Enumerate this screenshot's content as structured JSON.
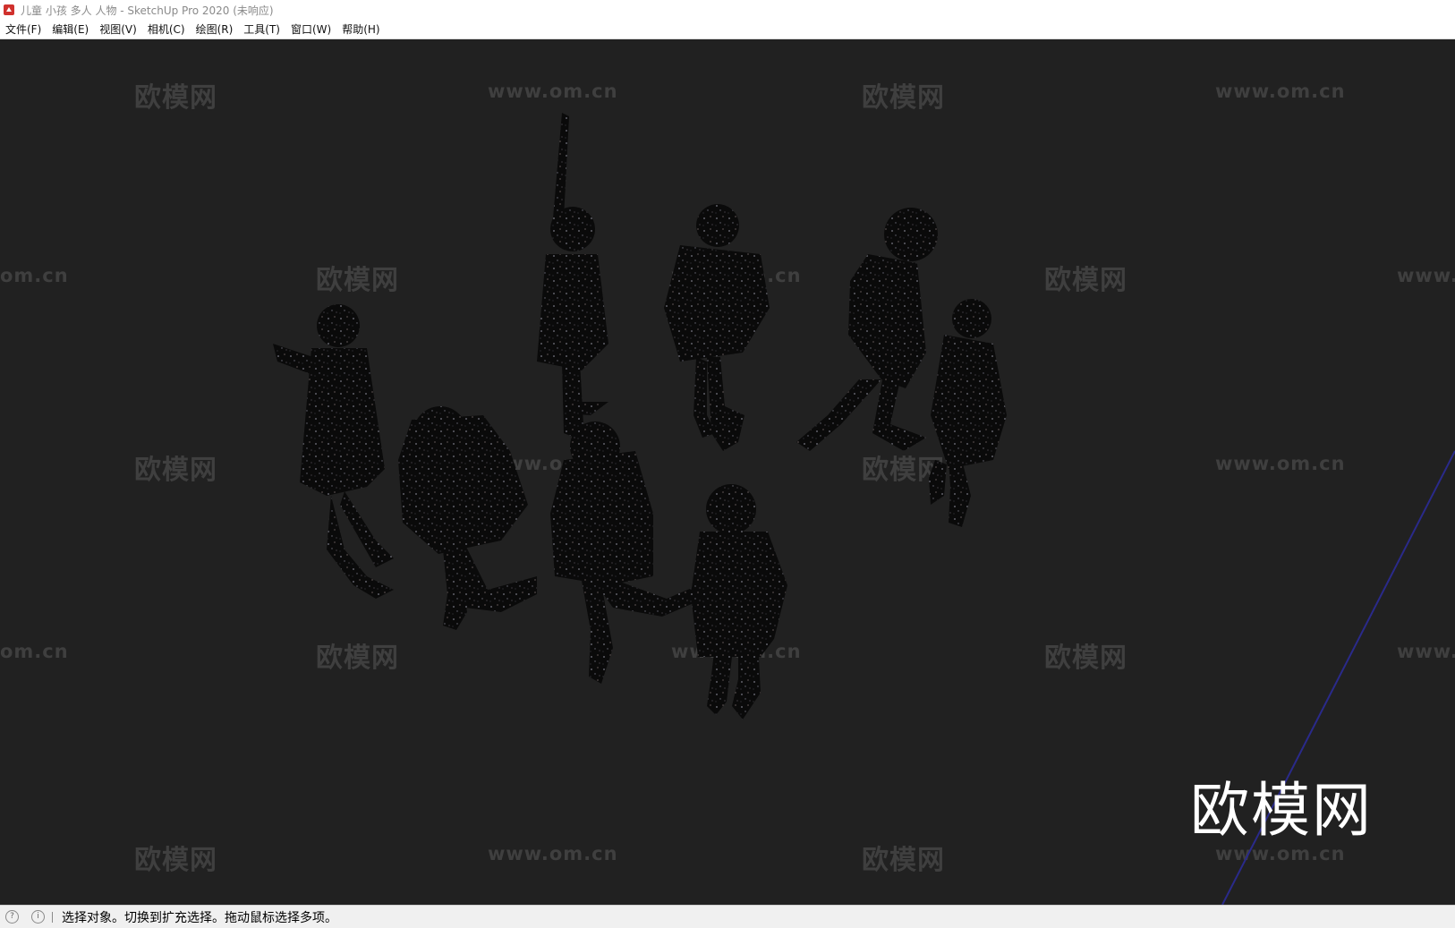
{
  "window": {
    "title": "儿童 小孩 多人 人物 - SketchUp Pro 2020 (未响应)",
    "app_icon": "sketchup-logo-icon"
  },
  "menubar": {
    "items": [
      {
        "label": "文件(F)"
      },
      {
        "label": "编辑(E)"
      },
      {
        "label": "视图(V)"
      },
      {
        "label": "相机(C)"
      },
      {
        "label": "绘图(R)"
      },
      {
        "label": "工具(T)"
      },
      {
        "label": "窗口(W)"
      },
      {
        "label": "帮助(H)"
      }
    ]
  },
  "viewport": {
    "background": "#212121",
    "axis_color": "#2a2a8a",
    "watermark_text": "欧模网",
    "watermark_url": "www.om.cn",
    "watermark_url_partial_left": "om.cn",
    "watermark_url_partial_right": "www.",
    "logo_text": "欧模网",
    "figure_count": 8
  },
  "statusbar": {
    "icons": [
      "geo-location-icon",
      "info-icon"
    ],
    "message": "选择对象。切换到扩充选择。拖动鼠标选择多项。"
  }
}
